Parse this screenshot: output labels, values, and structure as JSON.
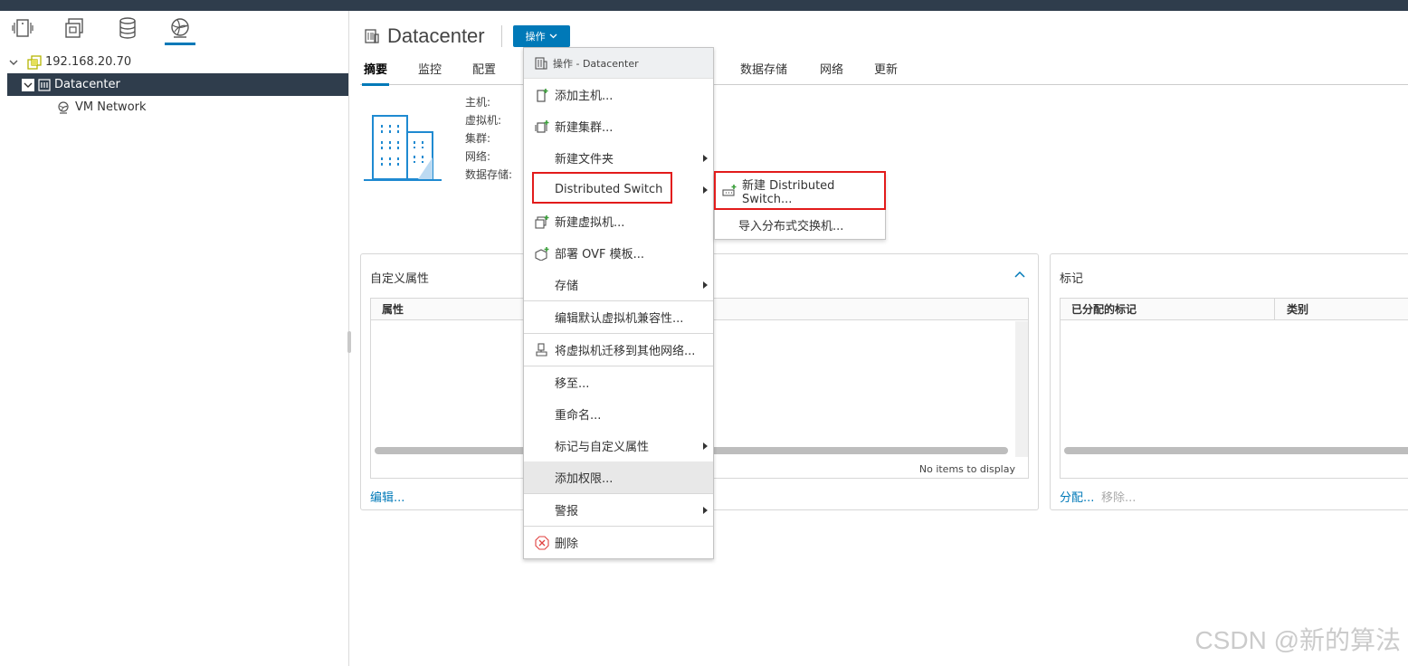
{
  "nav": {
    "tabs": [
      {
        "icon": "hosts-and-clusters-icon"
      },
      {
        "icon": "vms-and-templates-icon"
      },
      {
        "icon": "storage-icon"
      },
      {
        "icon": "networking-icon"
      }
    ],
    "tree": [
      {
        "label": "192.168.20.70",
        "icon": "vcenter-icon"
      },
      {
        "label": "Datacenter",
        "icon": "datacenter-icon",
        "selected": true
      },
      {
        "label": "VM Network",
        "icon": "network-icon"
      }
    ]
  },
  "header": {
    "title": "Datacenter",
    "actions_label": "操作"
  },
  "tabs": [
    "摘要",
    "监控",
    "配置",
    "数据存储",
    "网络",
    "更新"
  ],
  "info": {
    "labels": [
      "主机:",
      "虚拟机:",
      "集群:",
      "网络:",
      "数据存储:"
    ]
  },
  "custom_attributes": {
    "title": "自定义属性",
    "column": "属性",
    "empty_text": "No items to display",
    "edit_link": "编辑..."
  },
  "tags": {
    "title": "标记",
    "columns": [
      "已分配的标记",
      "类别"
    ],
    "assign_link": "分配...",
    "remove_link": "移除..."
  },
  "actions_menu": {
    "header": "操作 - Datacenter",
    "items": [
      {
        "label": "添加主机...",
        "icon": "add-host-icon"
      },
      {
        "label": "新建集群...",
        "icon": "new-cluster-icon"
      },
      {
        "label": "新建文件夹",
        "submenu": true
      },
      {
        "label": "Distributed Switch",
        "submenu": true,
        "highlighted_box": true
      },
      {
        "label": "新建虚拟机...",
        "icon": "new-vm-icon"
      },
      {
        "label": "部署 OVF 模板...",
        "icon": "deploy-ovf-icon"
      },
      {
        "label": "存储",
        "submenu": true
      },
      {
        "label": "编辑默认虚拟机兼容性..."
      },
      {
        "label": "将虚拟机迁移到其他网络...",
        "icon": "migrate-network-icon"
      },
      {
        "label": "移至..."
      },
      {
        "label": "重命名..."
      },
      {
        "label": "标记与自定义属性",
        "submenu": true
      },
      {
        "label": "添加权限...",
        "hovered": true
      },
      {
        "label": "警报",
        "submenu": true
      },
      {
        "label": "删除",
        "icon": "delete-icon"
      }
    ]
  },
  "ds_submenu": {
    "items": [
      {
        "label": "新建 Distributed Switch...",
        "icon": "new-dvswitch-icon"
      },
      {
        "label": "导入分布式交换机..."
      }
    ]
  },
  "watermark": "CSDN @新的算法",
  "colors": {
    "accent": "#0079b8",
    "nav_selected": "#2f3d4c",
    "highlight_box": "#e21b1b"
  }
}
